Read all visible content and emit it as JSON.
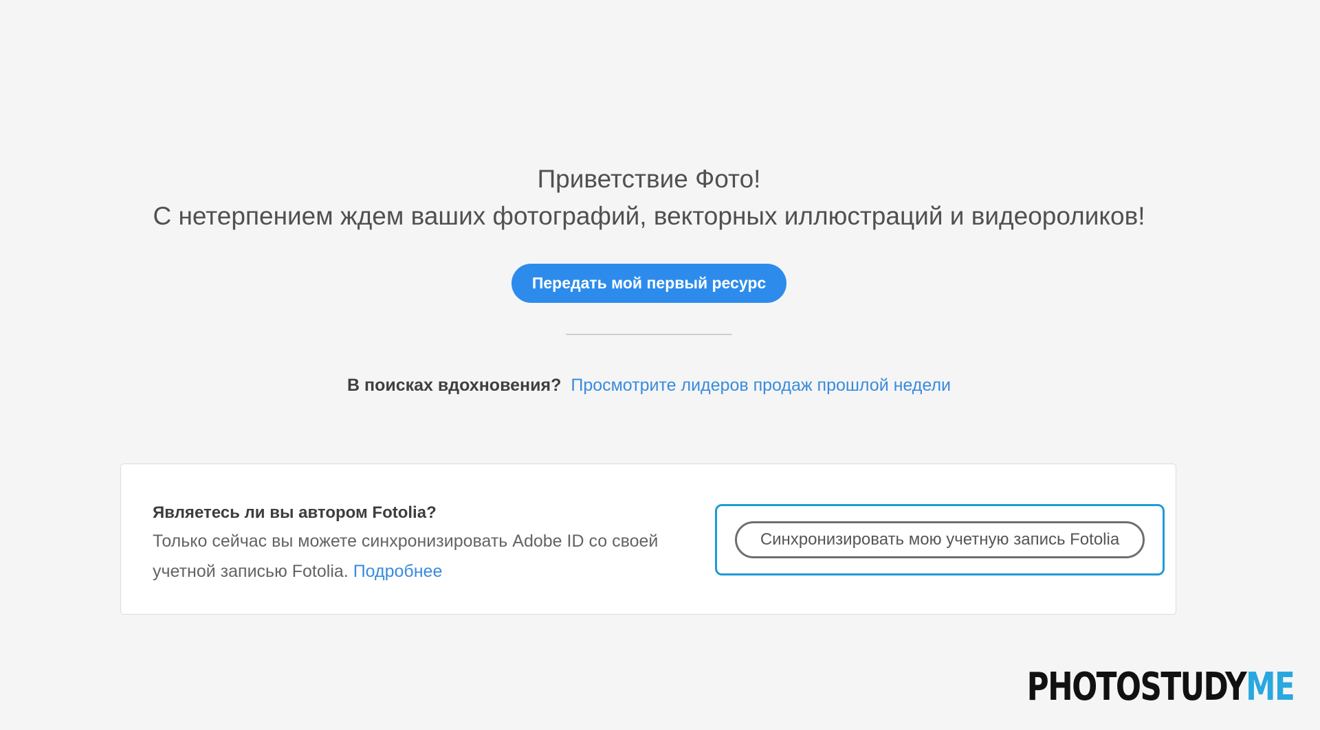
{
  "hero": {
    "line1": "Приветствие Фото!",
    "line2": "С нетерпением ждем ваших фотографий, векторных иллюстраций и видеороликов!",
    "cta_label": "Передать мой первый ресурс"
  },
  "inspire": {
    "question": "В поисках вдохновения?",
    "link_label": "Просмотрите лидеров продаж прошлой недели"
  },
  "fotolia_card": {
    "title": "Являетесь ли вы автором Fotolia?",
    "description": "Только сейчас вы можете синхронизировать Adobe ID со своей учетной записью Fotolia.",
    "more_link": "Подробнее",
    "sync_button_label": "Синхронизировать мою учетную запись Fotolia"
  },
  "watermark": {
    "part1": "PHOTOSTUDY",
    "part2": "ME"
  },
  "colors": {
    "background": "#f5f5f5",
    "primary_button": "#2d8ceb",
    "link": "#3a8bdc",
    "focus_ring": "#1e9ad6",
    "logo_accent": "#29a8e0"
  }
}
